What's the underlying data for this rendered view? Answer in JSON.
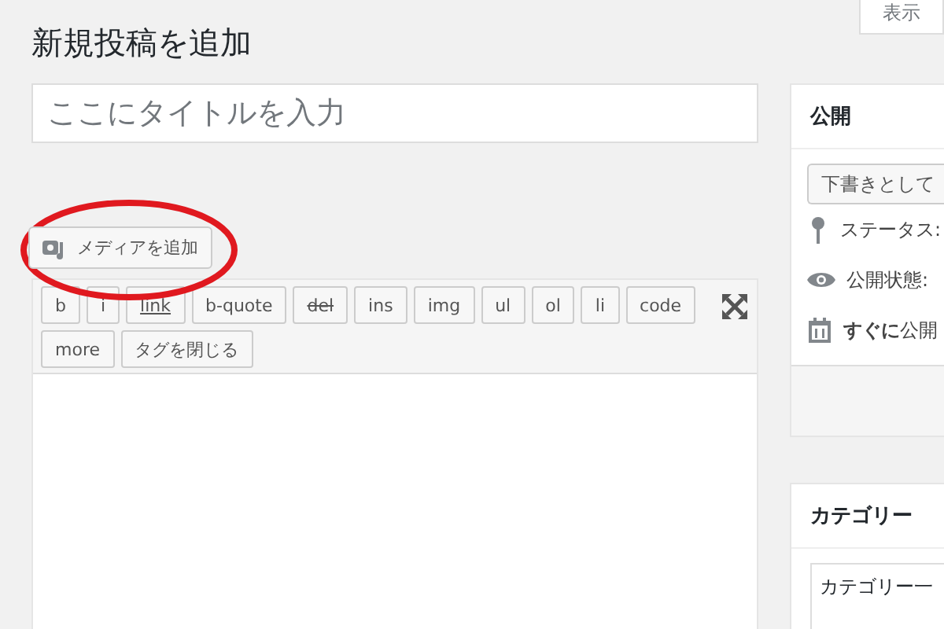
{
  "screen_options_tab": "表示",
  "page_title": "新規投稿を追加",
  "title_field": {
    "placeholder": "ここにタイトルを入力"
  },
  "add_media_button": "メディアを追加",
  "quicktags": [
    {
      "label": "b",
      "kind": "plain"
    },
    {
      "label": "i",
      "kind": "plain"
    },
    {
      "label": "link",
      "kind": "underline"
    },
    {
      "label": "b-quote",
      "kind": "plain"
    },
    {
      "label": "del",
      "kind": "strike"
    },
    {
      "label": "ins",
      "kind": "plain"
    },
    {
      "label": "img",
      "kind": "plain"
    },
    {
      "label": "ul",
      "kind": "plain"
    },
    {
      "label": "ol",
      "kind": "plain"
    },
    {
      "label": "li",
      "kind": "plain"
    },
    {
      "label": "code",
      "kind": "plain"
    },
    {
      "label": "more",
      "kind": "plain"
    },
    {
      "label": "タグを閉じる",
      "kind": "plain"
    }
  ],
  "publish_box": {
    "title": "公開",
    "save_draft_button": "下書きとして",
    "rows": [
      {
        "kind": "pin",
        "text": "ステータス:"
      },
      {
        "kind": "eye",
        "text": "公開状態:"
      },
      {
        "kind": "calendar",
        "text": "**すぐに**公開"
      }
    ]
  },
  "category_box": {
    "title": "カテゴリー",
    "tab": "カテゴリー一"
  }
}
